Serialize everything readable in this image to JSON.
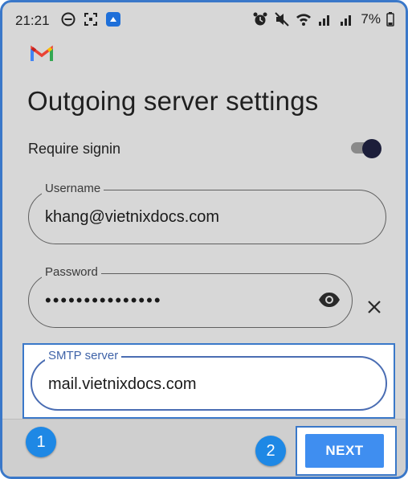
{
  "status_bar": {
    "time": "21:21",
    "battery": "7%",
    "icons_left": [
      "do-not-disturb-icon",
      "screenshot-icon",
      "app-notification-icon"
    ],
    "icons_right": [
      "alarm-icon",
      "mute-icon",
      "wifi-icon",
      "signal-icon",
      "signal-icon",
      "battery-icon"
    ]
  },
  "header": {
    "logo": "gmail-logo-icon"
  },
  "page": {
    "title": "Outgoing server settings",
    "require_signin_label": "Require signin",
    "require_signin_on": true
  },
  "fields": {
    "username": {
      "label": "Username",
      "value": "khang@vietnixdocs.com"
    },
    "password": {
      "label": "Password",
      "value": "•••••••••••••••"
    },
    "smtp": {
      "label": "SMTP server",
      "value": "mail.vietnixdocs.com"
    }
  },
  "footer": {
    "next_label": "NEXT",
    "step1": "1",
    "step2": "2"
  },
  "colors": {
    "accent": "#3a78c9",
    "button": "#3f8ef0",
    "badge": "#1e88e5",
    "toggle_thumb": "#1c1e3a"
  }
}
